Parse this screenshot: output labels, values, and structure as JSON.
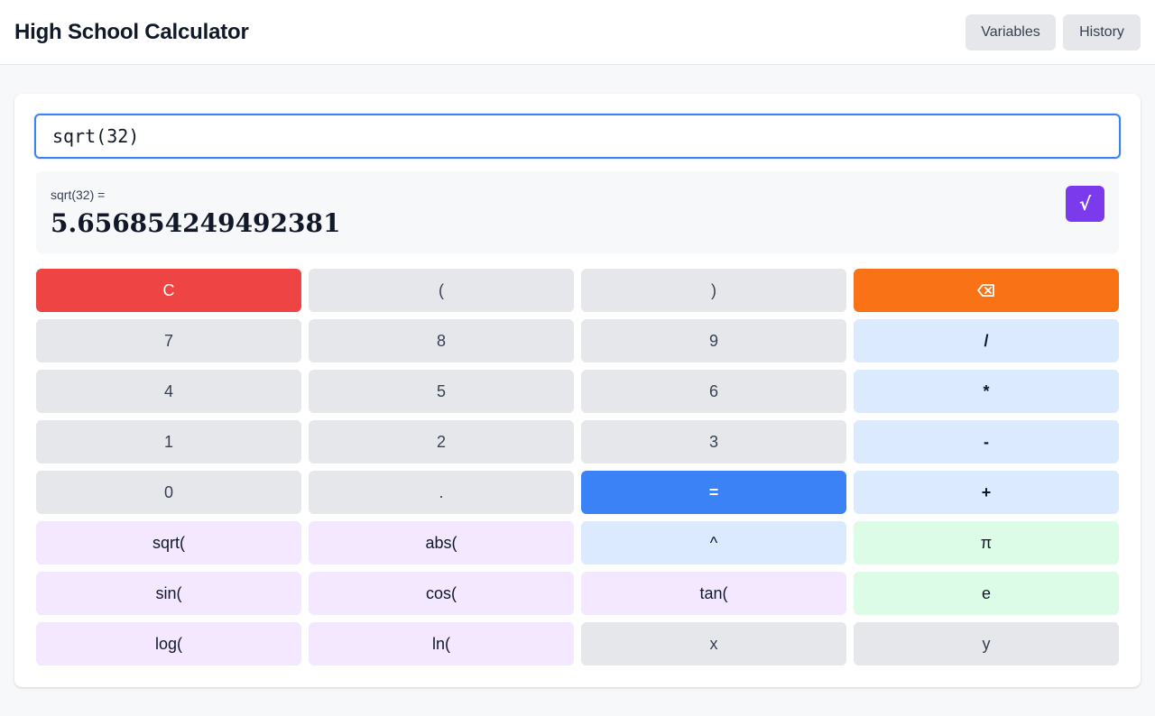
{
  "header": {
    "title": "High School Calculator",
    "variables_label": "Variables",
    "history_label": "History"
  },
  "input": {
    "value": "sqrt(32)"
  },
  "result": {
    "expression": "sqrt(32) =",
    "value": "5.656854249492381",
    "sqrt_badge": "√"
  },
  "keypad": {
    "keys": [
      {
        "label": "C",
        "name": "clear-key",
        "style": "k-red"
      },
      {
        "label": "(",
        "name": "open-paren-key",
        "style": "k-gray"
      },
      {
        "label": ")",
        "name": "close-paren-key",
        "style": "k-gray"
      },
      {
        "label": "",
        "name": "backspace-key",
        "style": "k-orange",
        "icon": "backspace-icon"
      },
      {
        "label": "7",
        "name": "digit-7-key",
        "style": "k-gray"
      },
      {
        "label": "8",
        "name": "digit-8-key",
        "style": "k-gray"
      },
      {
        "label": "9",
        "name": "digit-9-key",
        "style": "k-gray"
      },
      {
        "label": "/",
        "name": "divide-key",
        "style": "k-op"
      },
      {
        "label": "4",
        "name": "digit-4-key",
        "style": "k-gray"
      },
      {
        "label": "5",
        "name": "digit-5-key",
        "style": "k-gray"
      },
      {
        "label": "6",
        "name": "digit-6-key",
        "style": "k-gray"
      },
      {
        "label": "*",
        "name": "multiply-key",
        "style": "k-op"
      },
      {
        "label": "1",
        "name": "digit-1-key",
        "style": "k-gray"
      },
      {
        "label": "2",
        "name": "digit-2-key",
        "style": "k-gray"
      },
      {
        "label": "3",
        "name": "digit-3-key",
        "style": "k-gray"
      },
      {
        "label": "-",
        "name": "subtract-key",
        "style": "k-op"
      },
      {
        "label": "0",
        "name": "digit-0-key",
        "style": "k-gray"
      },
      {
        "label": ".",
        "name": "decimal-key",
        "style": "k-gray"
      },
      {
        "label": "=",
        "name": "equals-key",
        "style": "k-eq"
      },
      {
        "label": "+",
        "name": "add-key",
        "style": "k-op"
      },
      {
        "label": "sqrt(",
        "name": "sqrt-key",
        "style": "k-fn"
      },
      {
        "label": "abs(",
        "name": "abs-key",
        "style": "k-fn"
      },
      {
        "label": "^",
        "name": "power-key",
        "style": "k-pow"
      },
      {
        "label": "π",
        "name": "pi-key",
        "style": "k-const"
      },
      {
        "label": "sin(",
        "name": "sin-key",
        "style": "k-fn"
      },
      {
        "label": "cos(",
        "name": "cos-key",
        "style": "k-fn"
      },
      {
        "label": "tan(",
        "name": "tan-key",
        "style": "k-fn"
      },
      {
        "label": "e",
        "name": "euler-key",
        "style": "k-const"
      },
      {
        "label": "log(",
        "name": "log-key",
        "style": "k-fn"
      },
      {
        "label": "ln(",
        "name": "ln-key",
        "style": "k-fn"
      },
      {
        "label": "x",
        "name": "var-x-key",
        "style": "k-var"
      },
      {
        "label": "y",
        "name": "var-y-key",
        "style": "k-var"
      }
    ]
  },
  "colors": {
    "accent": "#3b82f6",
    "clear": "#ef4444",
    "backspace": "#f97316",
    "sqrt_badge": "#7c3aed",
    "operator": "#dbeafe",
    "function": "#f3e8ff",
    "constant": "#dcfce7",
    "neutral": "#e5e7eb"
  }
}
